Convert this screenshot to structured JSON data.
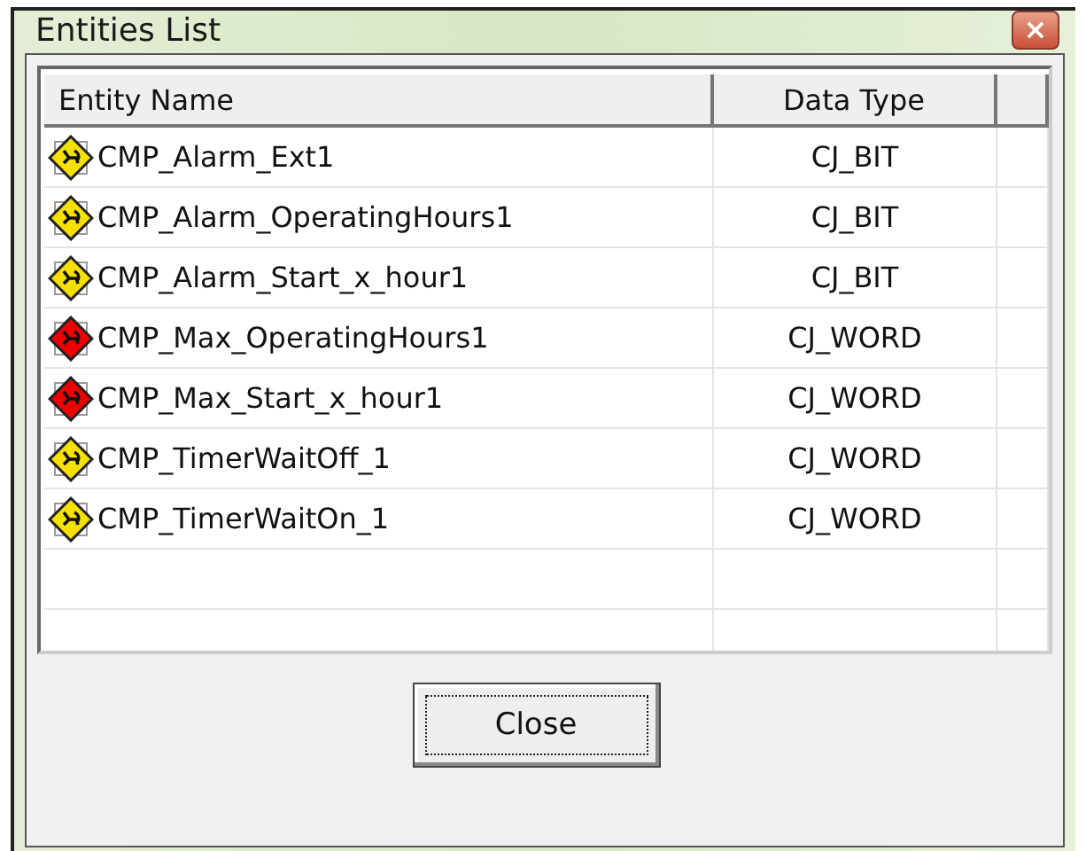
{
  "window": {
    "title": "Entities List",
    "close_glyph": "×"
  },
  "table": {
    "columns": [
      "Entity Name",
      "Data Type"
    ],
    "rows": [
      {
        "name": "CMP_Alarm_Ext1",
        "type": "CJ_BIT",
        "color": "#f5e000"
      },
      {
        "name": "CMP_Alarm_OperatingHours1",
        "type": "CJ_BIT",
        "color": "#f5e000"
      },
      {
        "name": "CMP_Alarm_Start_x_hour1",
        "type": "CJ_BIT",
        "color": "#f5e000"
      },
      {
        "name": "CMP_Max_OperatingHours1",
        "type": "CJ_WORD",
        "color": "#ee0000"
      },
      {
        "name": "CMP_Max_Start_x_hour1",
        "type": "CJ_WORD",
        "color": "#ee0000"
      },
      {
        "name": "CMP_TimerWaitOff_1",
        "type": "CJ_WORD",
        "color": "#f5e000"
      },
      {
        "name": "CMP_TimerWaitOn_1",
        "type": "CJ_WORD",
        "color": "#f5e000"
      }
    ]
  },
  "buttons": [
    "Close"
  ]
}
